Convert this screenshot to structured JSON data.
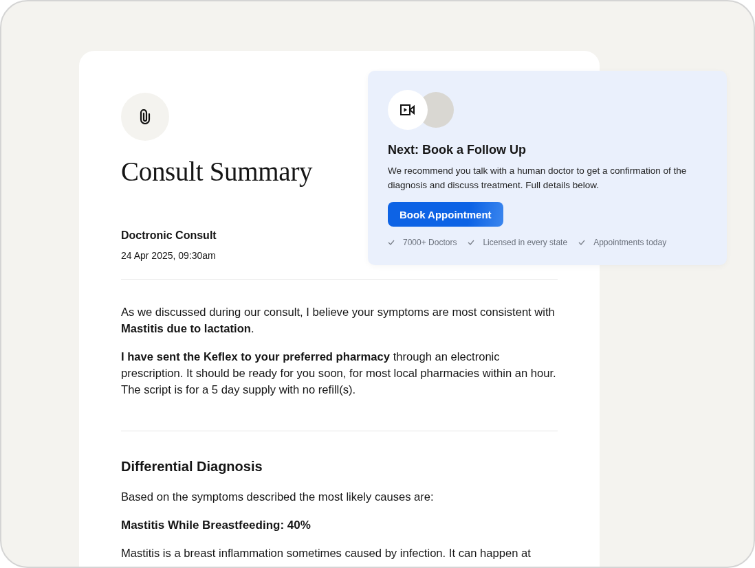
{
  "summary": {
    "title": "Consult Summary",
    "source": "Doctronic Consult",
    "datetime": "24 Apr 2025, 09:30am",
    "paragraphs": [
      "As we discussed during our consult, I believe your symptoms are most consistent with **Mastitis due to lactation**.",
      "**I have sent the Keflex to your preferred pharmacy** through an electronic prescription. It should be ready for you soon, for most local pharmacies within an hour. The script is for a 5 day supply with no refill(s)."
    ],
    "section": {
      "heading": "Differential Diagnosis",
      "intro": "Based on the symptoms described the most likely causes are:",
      "causes": [
        {
          "title": "Mastitis While Breastfeeding: 40%",
          "text": "Mastitis is a breast inflammation sometimes caused by infection. It can happen at"
        }
      ]
    }
  },
  "follow_up": {
    "title": "Next: Book a Follow Up",
    "text": "We recommend you talk with a human doctor to get a confirmation of the diagnosis and discuss treatment. Full details below.",
    "button": "Book Appointment",
    "features": [
      "7000+ Doctors",
      "Licensed in every state",
      "Appointments today"
    ]
  }
}
